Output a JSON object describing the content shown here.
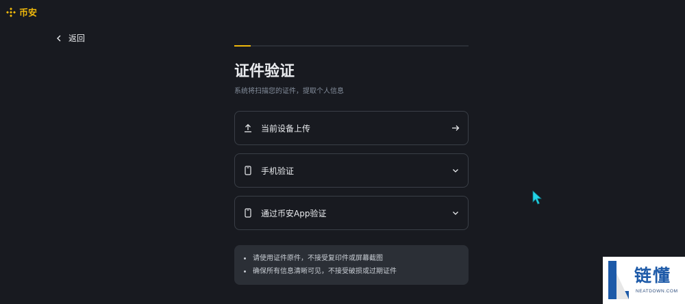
{
  "header": {
    "logo_text": "币安",
    "brand_color": "#f0b90b"
  },
  "nav": {
    "back_label": "返回"
  },
  "progress": {
    "current_step": 1,
    "fraction": 0.07
  },
  "page": {
    "title": "证件验证",
    "subtitle": "系统将扫描您的证件，提取个人信息"
  },
  "options": [
    {
      "label": "当前设备上传",
      "icon": "upload-icon",
      "end_icon": "arrow-right-icon"
    },
    {
      "label": "手机验证",
      "icon": "phone-icon",
      "end_icon": "chevron-down-icon"
    },
    {
      "label": "通过币安App验证",
      "icon": "phone-icon",
      "end_icon": "chevron-down-icon"
    }
  ],
  "notes": [
    "请使用证件原件，不接受复印件或屏幕截图",
    "确保所有信息清晰可见，不接受破损或过期证件"
  ],
  "watermark": {
    "text": "链懂",
    "sub": "NEATDOWN.COM"
  }
}
